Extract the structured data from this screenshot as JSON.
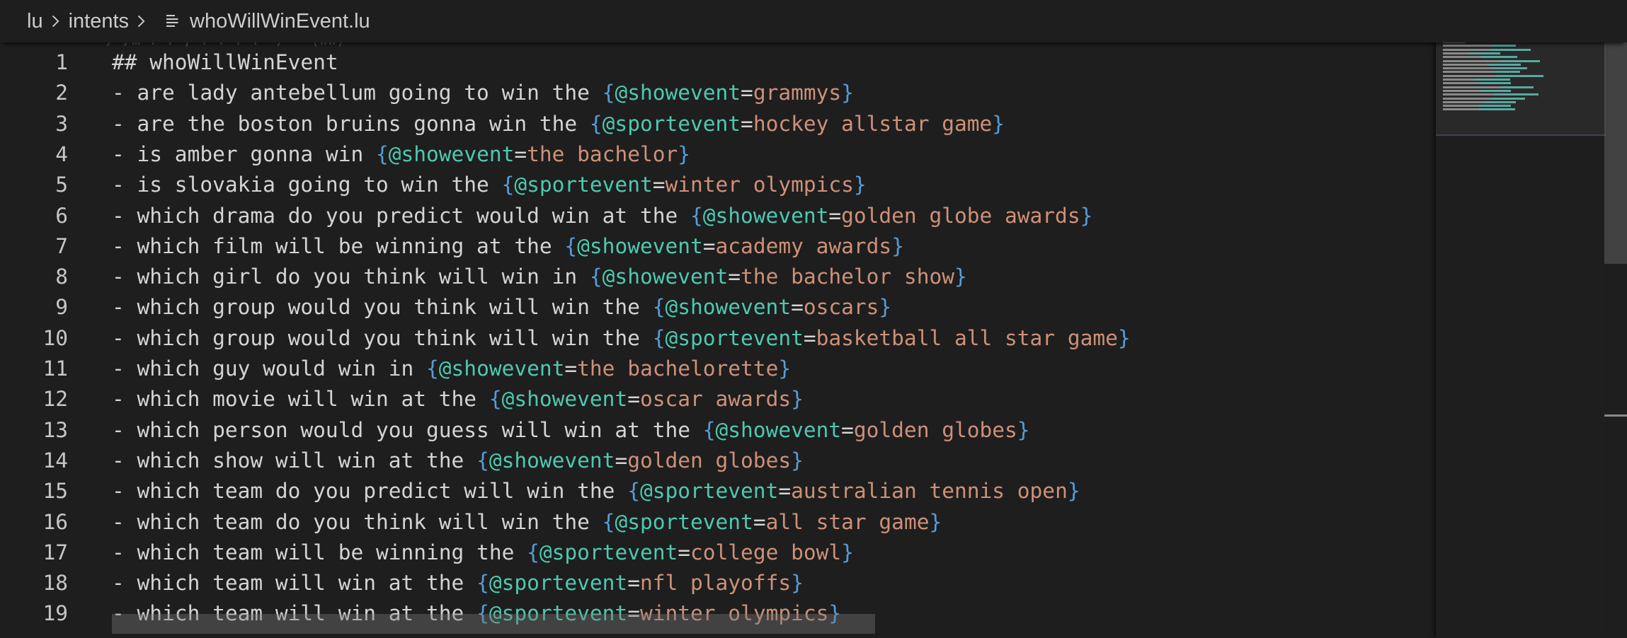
{
  "breadcrumb": {
    "items": [
      "lu",
      "intents"
    ],
    "file": "whoWillWinEvent.lu"
  },
  "peek_text": "/ /… . . , . . . .  /   (ww)",
  "editor": {
    "lines": [
      {
        "num": "1",
        "type": "heading",
        "text": "## whoWillWinEvent"
      },
      {
        "num": "2",
        "type": "utterance",
        "prefix": "- are lady antebellum going to win the ",
        "entity": "@showevent",
        "value": "grammys"
      },
      {
        "num": "3",
        "type": "utterance",
        "prefix": "- are the boston bruins gonna win the ",
        "entity": "@sportevent",
        "value": "hockey allstar game"
      },
      {
        "num": "4",
        "type": "utterance",
        "prefix": "- is amber gonna win ",
        "entity": "@showevent",
        "value": "the bachelor"
      },
      {
        "num": "5",
        "type": "utterance",
        "prefix": "- is slovakia going to win the ",
        "entity": "@sportevent",
        "value": "winter olympics"
      },
      {
        "num": "6",
        "type": "utterance",
        "prefix": "- which drama do you predict would win at the ",
        "entity": "@showevent",
        "value": "golden globe awards"
      },
      {
        "num": "7",
        "type": "utterance",
        "prefix": "- which film will be winning at the ",
        "entity": "@showevent",
        "value": "academy awards"
      },
      {
        "num": "8",
        "type": "utterance",
        "prefix": "- which girl do you think will win in ",
        "entity": "@showevent",
        "value": "the bachelor show"
      },
      {
        "num": "9",
        "type": "utterance",
        "prefix": "- which group would you think will win the ",
        "entity": "@showevent",
        "value": "oscars"
      },
      {
        "num": "10",
        "type": "utterance",
        "prefix": "- which group would you think will win the ",
        "entity": "@sportevent",
        "value": "basketball all star game"
      },
      {
        "num": "11",
        "type": "utterance",
        "prefix": "- which guy would win in ",
        "entity": "@showevent",
        "value": "the bachelorette"
      },
      {
        "num": "12",
        "type": "utterance",
        "prefix": "- which movie will win at the ",
        "entity": "@showevent",
        "value": "oscar awards"
      },
      {
        "num": "13",
        "type": "utterance",
        "prefix": "- which person would you guess will win at the ",
        "entity": "@showevent",
        "value": "golden globes"
      },
      {
        "num": "14",
        "type": "utterance",
        "prefix": "- which show will win at the ",
        "entity": "@showevent",
        "value": "golden globes"
      },
      {
        "num": "15",
        "type": "utterance",
        "prefix": "- which team do you predict will win the ",
        "entity": "@sportevent",
        "value": "australian tennis open"
      },
      {
        "num": "16",
        "type": "utterance",
        "prefix": "- which team do you think will win the ",
        "entity": "@sportevent",
        "value": "all star game"
      },
      {
        "num": "17",
        "type": "utterance",
        "prefix": "- which team will be winning the ",
        "entity": "@sportevent",
        "value": "college bowl"
      },
      {
        "num": "18",
        "type": "utterance",
        "prefix": "- which team will win at the ",
        "entity": "@sportevent",
        "value": "nfl playoffs"
      },
      {
        "num": "19",
        "type": "utterance",
        "prefix": "- which team will win at the ",
        "entity": "@sportevent",
        "value": "winter olympics"
      }
    ]
  },
  "colors": {
    "background": "#1e1e1e",
    "text": "#d4d4d4",
    "brace": "#569cd6",
    "entity": "#4ec9b0",
    "value": "#ce9178",
    "line_number": "#c6c6c6"
  },
  "icons": {
    "breadcrumb_separator": "chevron-right-icon",
    "file": "file-lines-icon"
  }
}
